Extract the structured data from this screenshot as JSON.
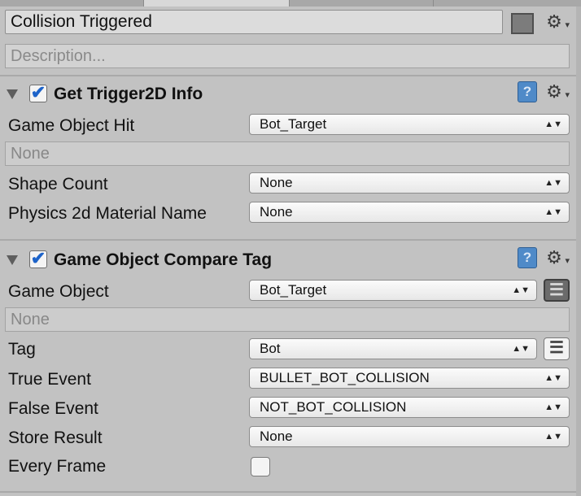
{
  "state": {
    "name": "Collision Triggered",
    "description_placeholder": "Description...",
    "color_swatch": "#7c7c7c",
    "gear_icon": "⚙"
  },
  "actions": [
    {
      "title": "Get Trigger2D Info",
      "enabled": true,
      "help_icon": "?",
      "fields": {
        "game_object_hit": {
          "label": "Game Object Hit",
          "value": "Bot_Target",
          "target_hint": "None"
        },
        "shape_count": {
          "label": "Shape Count",
          "value": "None"
        },
        "physics_material": {
          "label": "Physics 2d Material Name",
          "value": "None"
        }
      }
    },
    {
      "title": "Game Object Compare Tag",
      "enabled": true,
      "help_icon": "?",
      "fields": {
        "game_object": {
          "label": "Game Object",
          "value": "Bot_Target",
          "target_hint": "None"
        },
        "tag": {
          "label": "Tag",
          "value": "Bot"
        },
        "true_event": {
          "label": "True Event",
          "value": "BULLET_BOT_COLLISION"
        },
        "false_event": {
          "label": "False Event",
          "value": "NOT_BOT_COLLISION"
        },
        "store_result": {
          "label": "Store Result",
          "value": "None"
        },
        "every_frame": {
          "label": "Every Frame",
          "checked": false
        }
      }
    }
  ],
  "glyphs": {
    "checkmark": "✔",
    "popup_arrows": "▲▼",
    "var_toggle": "☰"
  }
}
